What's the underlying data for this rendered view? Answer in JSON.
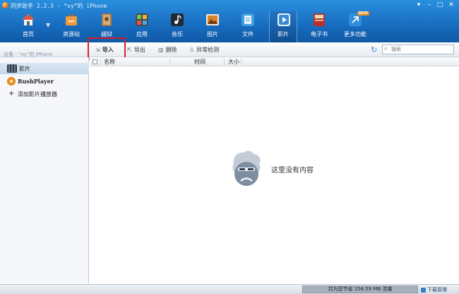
{
  "window": {
    "title": "同步助手 2.2.3 - “xy”的 iPhone",
    "controls": [
      "▾",
      "–",
      "□",
      "✕"
    ]
  },
  "nav": {
    "items": [
      {
        "label": "首页",
        "icon": "home-icon",
        "color": "#e8553c"
      },
      {
        "label": "资源站",
        "icon": "store-icon",
        "color": "#f29a38"
      },
      {
        "label": "越狱",
        "icon": "jailbreak-icon",
        "color": "#a6774a"
      },
      {
        "label": "应用",
        "icon": "apps-icon",
        "color": "#4aa6dc"
      },
      {
        "label": "音乐",
        "icon": "music-icon",
        "color": "#222222"
      },
      {
        "label": "图片",
        "icon": "photos-icon",
        "color": "#d7822c"
      },
      {
        "label": "文件",
        "icon": "files-icon",
        "color": "#3d9edd"
      },
      {
        "label": "影片",
        "icon": "movies-icon",
        "color": "#3a8bd4"
      },
      {
        "label": "电子书",
        "icon": "ebooks-icon",
        "color": "#b9312a"
      },
      {
        "label": "更多功能",
        "icon": "more-icon",
        "color": "#2f8fd8"
      }
    ],
    "active": "影片",
    "new_badge": "NEW"
  },
  "toolbar": {
    "device_label": "设备 - “xy”的 iPhone",
    "import_label": "导入",
    "export_label": "导出",
    "delete_label": "删除",
    "check_label": "异常检测",
    "search_placeholder": "搜索"
  },
  "sidebar": {
    "items": [
      {
        "label": "影片",
        "icon": "film-icon",
        "selected": true
      },
      {
        "label": "RushPlayer",
        "icon": "rushplayer-icon",
        "selected": false
      },
      {
        "label": "添加影片播放器",
        "icon": "plus-icon",
        "selected": false
      }
    ]
  },
  "table": {
    "columns": [
      "名称",
      "时间",
      "大小"
    ]
  },
  "empty_state": {
    "text": "这里没有内容"
  },
  "statusbar": {
    "traffic_text": "共为您节省 156.59 MB 流量",
    "download_manager": "下载管理"
  }
}
